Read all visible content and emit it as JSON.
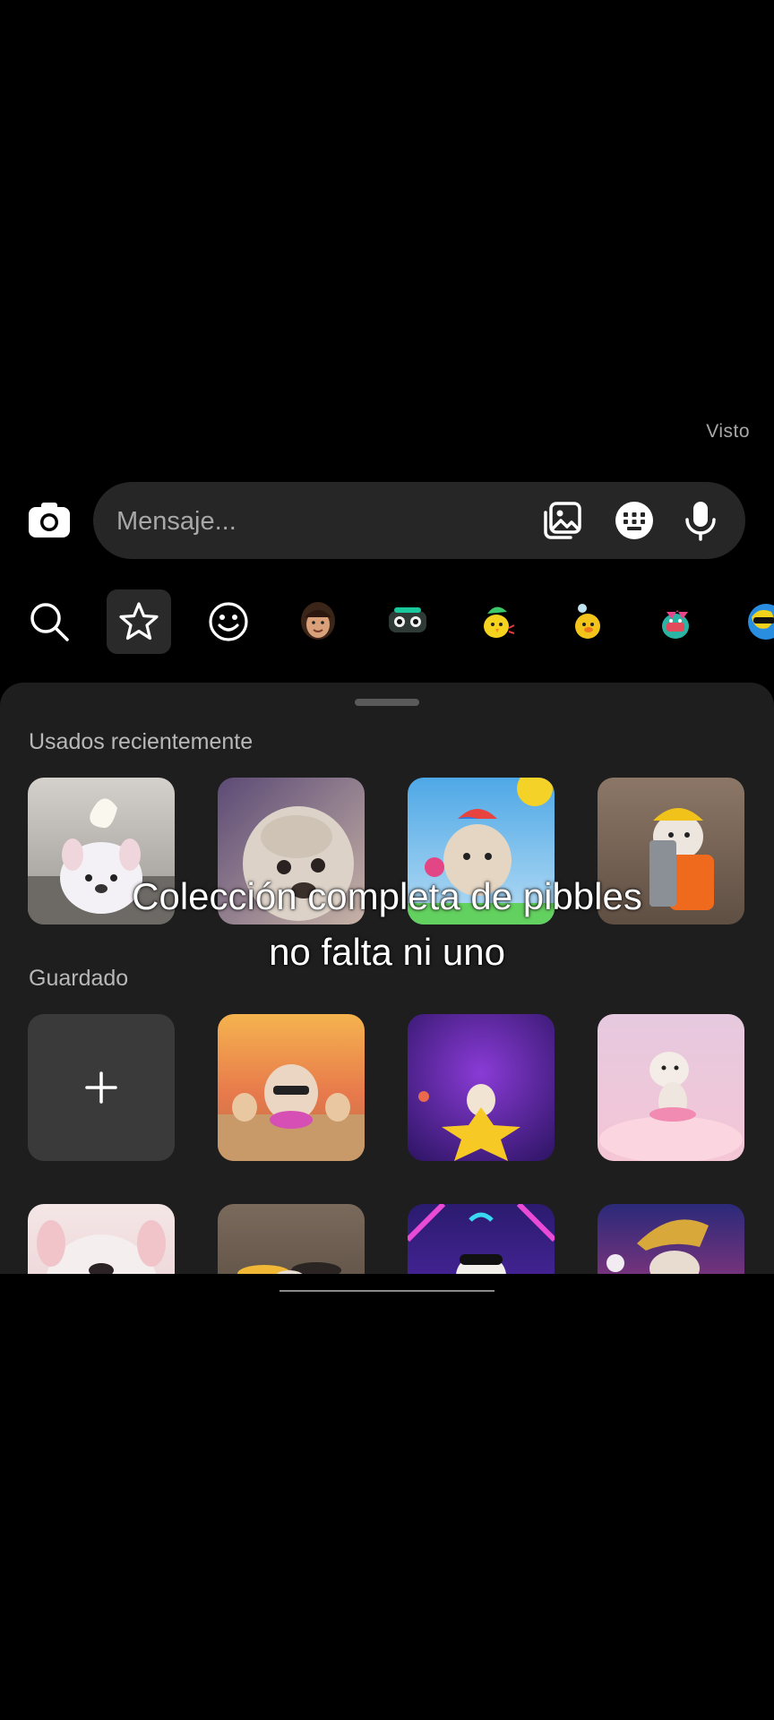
{
  "status": {
    "seen_label": "Visto"
  },
  "composer": {
    "placeholder": "Mensaje..."
  },
  "tray": {
    "icons": [
      "search-icon",
      "star-icon",
      "smiley-icon",
      "avatar-sticker",
      "robot-sticker",
      "chick-sticker",
      "duck-sticker",
      "dino-sticker",
      "blob-sticker"
    ]
  },
  "sheet": {
    "recent_title": "Usados recientemente",
    "saved_title": "Guardado",
    "add_symbol": "+"
  },
  "caption": {
    "line1": "Colección completa de pibbles",
    "line2": "no falta ni uno"
  },
  "colors": {
    "background": "#000000",
    "input_bar": "#262626",
    "sheet": "#1e1e1e",
    "muted_text": "#a8a8a8"
  }
}
